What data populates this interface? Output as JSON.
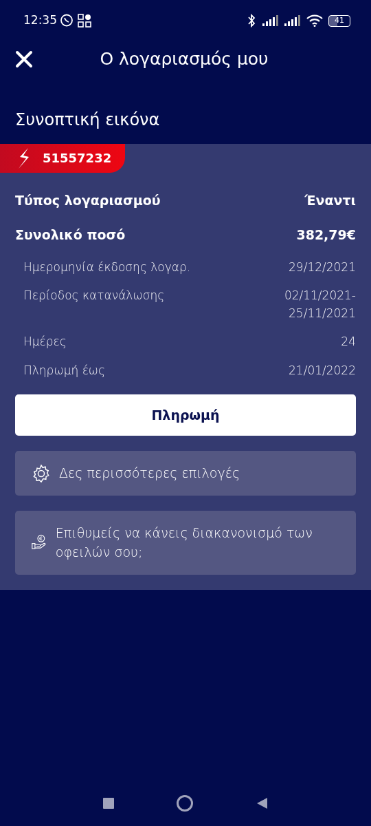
{
  "status_bar": {
    "time": "12:35",
    "battery": "41"
  },
  "header": {
    "title": "Ο λογαριασμός μου"
  },
  "section_title": "Συνοπτική εικόνα",
  "account": {
    "number": "51557232",
    "rows": [
      {
        "kind": "main",
        "label": "Τύπος λογαριασμού",
        "value": "Έναντι"
      },
      {
        "kind": "main",
        "label": "Συνολικό ποσό",
        "value": "382,79€"
      },
      {
        "kind": "detail",
        "label": "Ημερομηνία έκδοσης λογαρ.",
        "value": "29/12/2021"
      },
      {
        "kind": "detail",
        "label": "Περίοδος κατανάλωσης",
        "value": "02/11/2021-\n25/11/2021"
      },
      {
        "kind": "detail",
        "label": "Ημέρες",
        "value": "24"
      },
      {
        "kind": "detail",
        "label": "Πληρωμή έως",
        "value": "21/01/2022"
      }
    ],
    "pay_button": "Πληρωμή",
    "options": [
      {
        "kind": "gear",
        "label": "Δες περισσότερες επιλογές"
      },
      {
        "kind": "coin",
        "label": "Επιθυμείς να κάνεις διακανονισμό των οφειλών σου;"
      }
    ]
  }
}
